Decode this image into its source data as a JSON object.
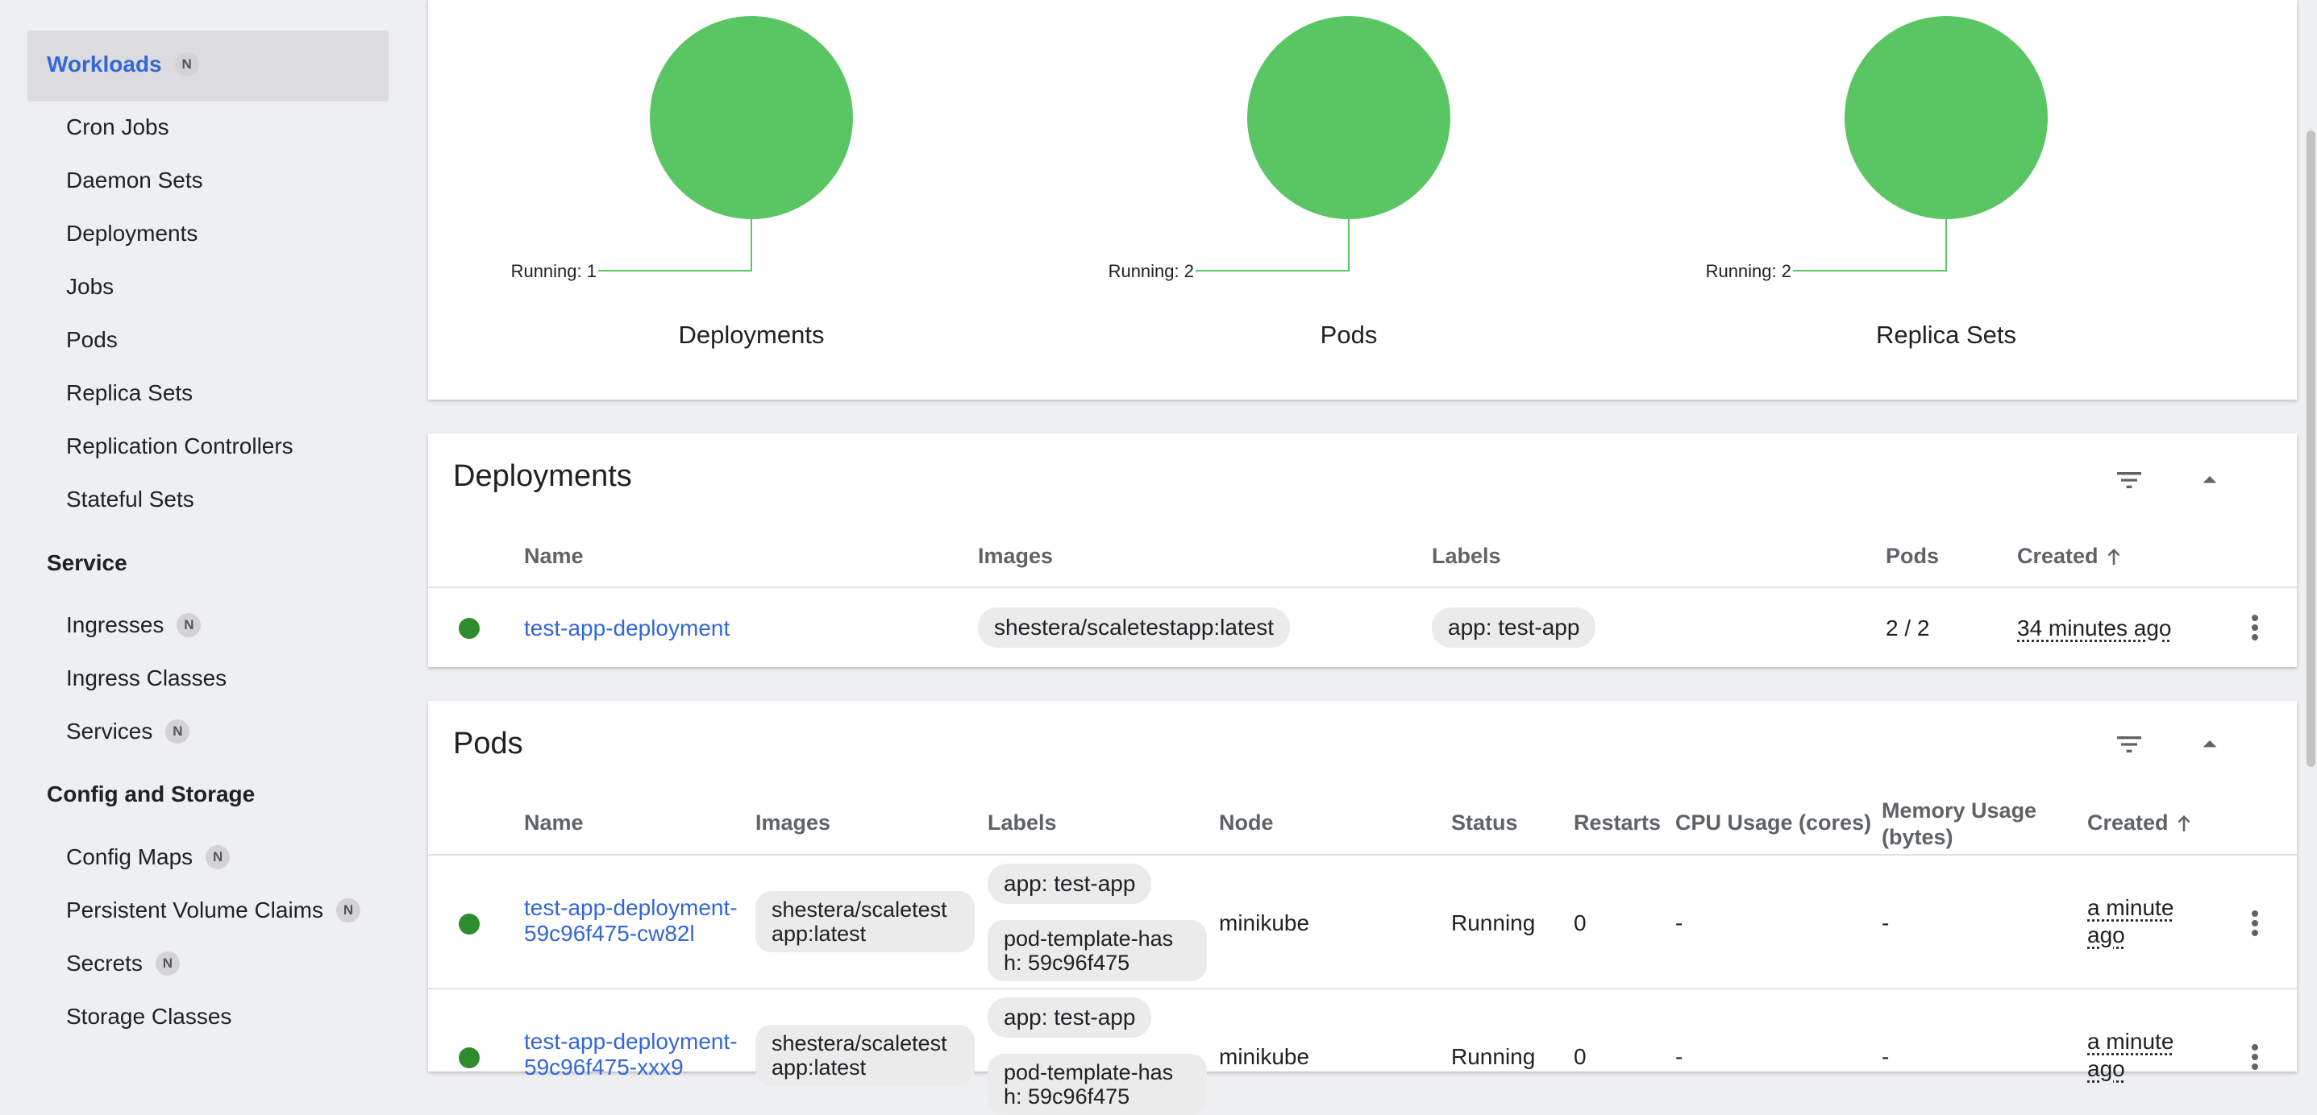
{
  "sidebar": {
    "active": {
      "label": "Workloads",
      "badge": "N"
    },
    "workloads": [
      "Cron Jobs",
      "Daemon Sets",
      "Deployments",
      "Jobs",
      "Pods",
      "Replica Sets",
      "Replication Controllers",
      "Stateful Sets"
    ],
    "service": {
      "title": "Service",
      "items": [
        {
          "label": "Ingresses",
          "badge": "N"
        },
        {
          "label": "Ingress Classes",
          "badge": ""
        },
        {
          "label": "Services",
          "badge": "N"
        }
      ]
    },
    "config": {
      "title": "Config and Storage",
      "items": [
        {
          "label": "Config Maps",
          "badge": "N"
        },
        {
          "label": "Persistent Volume Claims",
          "badge": "N"
        },
        {
          "label": "Secrets",
          "badge": "N"
        },
        {
          "label": "Storage Classes",
          "badge": ""
        }
      ]
    }
  },
  "workload_status": {
    "charts": [
      {
        "title": "Deployments",
        "label": "Running: 1",
        "running": 1,
        "color": "#5ac563"
      },
      {
        "title": "Pods",
        "label": "Running: 2",
        "running": 2,
        "color": "#5ac563"
      },
      {
        "title": "Replica Sets",
        "label": "Running: 2",
        "running": 2,
        "color": "#5ac563"
      }
    ]
  },
  "deployments": {
    "title": "Deployments",
    "columns": {
      "name": "Name",
      "images": "Images",
      "labels": "Labels",
      "pods": "Pods",
      "created": "Created"
    },
    "rows": [
      {
        "name": "test-app-deployment",
        "image": "shestera/scaletestapp:latest",
        "label": "app: test-app",
        "pods": "2 / 2",
        "created": "34 minutes ago"
      }
    ]
  },
  "pods": {
    "title": "Pods",
    "columns": {
      "name": "Name",
      "images": "Images",
      "labels": "Labels",
      "node": "Node",
      "status": "Status",
      "restarts": "Restarts",
      "cpu": "CPU Usage (cores)",
      "memory": "Memory Usage (bytes)",
      "created": "Created"
    },
    "rows": [
      {
        "name": "test-app-deployment-59c96f475-cw82l",
        "image": "shestera/scaletestapp:latest",
        "label1": "app: test-app",
        "label2": "pod-template-hash: 59c96f475",
        "node": "minikube",
        "status": "Running",
        "restarts": "0",
        "cpu": "-",
        "memory": "-",
        "created": "a minute ago"
      },
      {
        "name": "test-app-deployment-59c96f475-xxx9",
        "image": "shestera/scaletestapp:latest",
        "label1": "app: test-app",
        "label2": "pod-template-hash: 59c96f475",
        "node": "minikube",
        "status": "Running",
        "restarts": "0",
        "cpu": "-",
        "memory": "-",
        "created": "a minute ago"
      }
    ]
  },
  "colors": {
    "accent": "#3367d6",
    "running": "#2e8b2e",
    "chart": "#5ac563"
  },
  "icons": {
    "filter": "filter-icon",
    "collapse": "chevron-up-icon",
    "menu": "more-vert-icon",
    "sort": "arrow-up-icon"
  }
}
